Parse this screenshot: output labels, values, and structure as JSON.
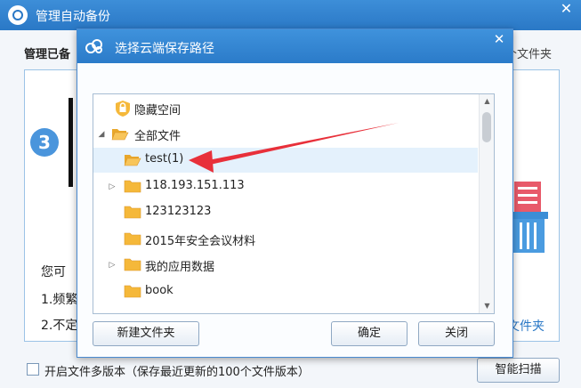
{
  "background_window": {
    "title": "管理自动备份",
    "close_label": "✕",
    "heading": "管理已备",
    "heading_right": "个文件夹",
    "step_number": "3",
    "text_1": "您可",
    "text_2": "1.频繁",
    "text_3": "2.不定",
    "link_text": "文件夹",
    "multi_version_label": "开启文件多版本（保存最近更新的100个文件版本）",
    "smart_scan_label": "智能扫描"
  },
  "dialog": {
    "title": "选择云端保存路径",
    "close_label": "✕",
    "tree": [
      {
        "label": "隐藏空间",
        "icon": "lock-shield-icon",
        "expander": ""
      },
      {
        "label": "全部文件",
        "icon": "folder-open-icon",
        "expander": "◢"
      },
      {
        "label": "test(1)",
        "icon": "folder-open-icon",
        "expander": ""
      },
      {
        "label": "118.193.151.113",
        "icon": "folder-icon",
        "expander": "▷"
      },
      {
        "label": "123123123",
        "icon": "folder-icon",
        "expander": ""
      },
      {
        "label": "2015年安全会议材料",
        "icon": "folder-icon",
        "expander": ""
      },
      {
        "label": "我的应用数据",
        "icon": "folder-icon",
        "expander": "▷"
      },
      {
        "label": "book",
        "icon": "folder-icon",
        "expander": ""
      }
    ],
    "scroll_up": "▲",
    "scroll_down": "▼",
    "new_folder_label": "新建文件夹",
    "confirm_label": "确定",
    "close_button_label": "关闭"
  },
  "colors": {
    "titlebar": "#2a78c6",
    "folder": "#f5b83a",
    "selected_row": "#e4f1fc",
    "arrow": "#e8303a"
  }
}
